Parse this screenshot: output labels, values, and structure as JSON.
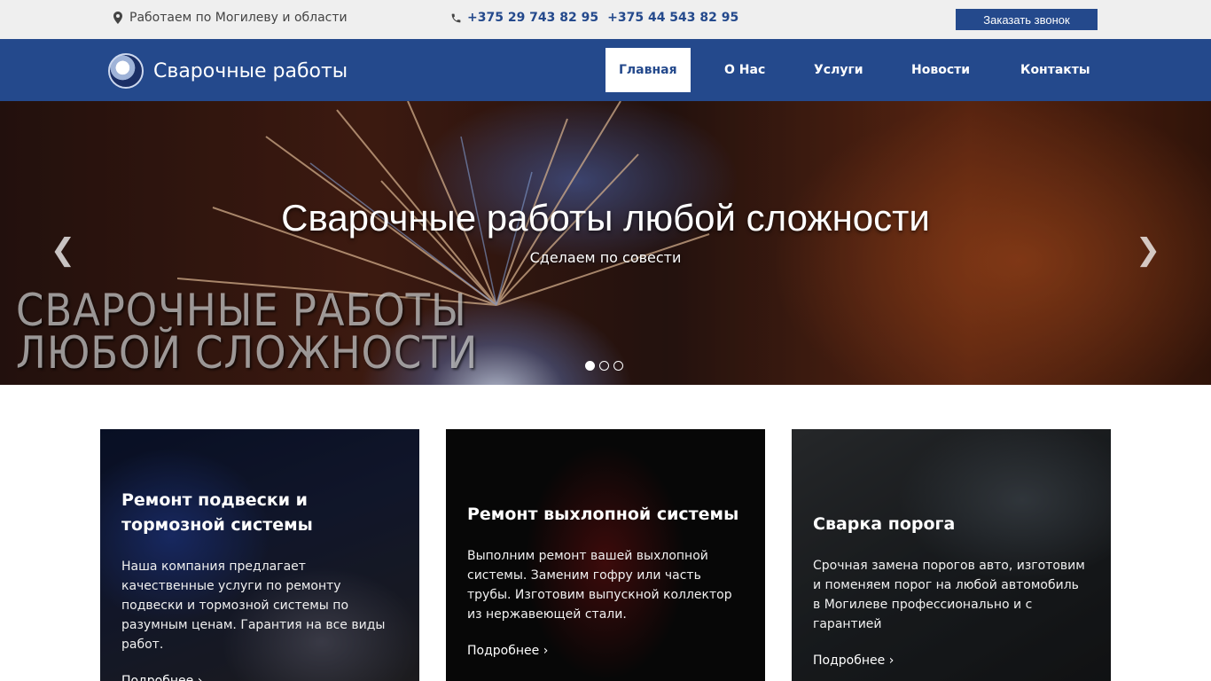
{
  "topbar": {
    "location_text": "Работаем по Могилеву и области",
    "location_icon": "map-pin-icon",
    "phone_icon": "phone-icon",
    "phone_1": "+375 29 743 82 95",
    "phone_2": "+375 44 543 82 95",
    "callback_button": "Заказать звонок"
  },
  "navbar": {
    "logo_text": "Сварочные работы",
    "items": [
      {
        "label": "Главная",
        "active": true
      },
      {
        "label": "О Нас"
      },
      {
        "label": "Услуги"
      },
      {
        "label": "Новости"
      },
      {
        "label": "Контакты"
      }
    ]
  },
  "hero": {
    "title": "Сварочные работы любой сложности",
    "subtitle": "Сделаем по совести",
    "image_caption_line1": "СВАРОЧНЫЕ РАБОТЫ",
    "image_caption_line2": "ЛЮБОЙ СЛОЖНОСТИ",
    "prev_glyph": "❮",
    "next_glyph": "❯",
    "slides_count": 3,
    "active_slide": 1
  },
  "cards": [
    {
      "title": "Ремонт подвески и тормозной системы",
      "text": "Наша компания предлагает качественные услуги по ремонту подвески и тормозной системы по разумным ценам. Гарантия на все виды работ.",
      "more": "Подробнее ›"
    },
    {
      "title": "Ремонт выхлопной системы",
      "text": "Выполним ремонт вашей выхлопной системы. Заменим гофру или часть трубы. Изготовим выпускной коллектор из нержавеющей стали.",
      "more": "Подробнее ›"
    },
    {
      "title": "Сварка порога",
      "text": "Срочная замена порогов авто, изготовим и поменяем порог на любой автомобиль в Могилеве профессионально и с гарантией",
      "more": "Подробнее ›"
    }
  ],
  "colors": {
    "brand_blue": "#24498c",
    "topbar_bg": "#efefef"
  }
}
